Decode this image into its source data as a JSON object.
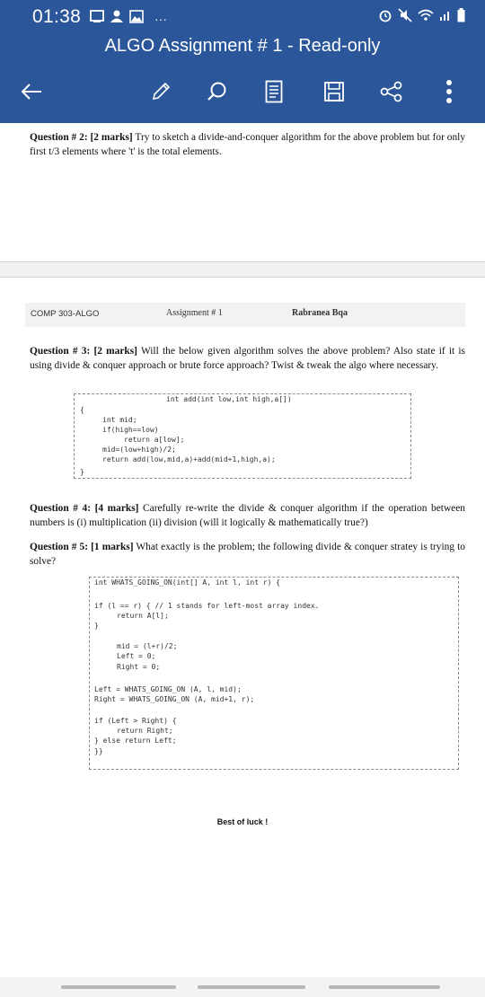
{
  "status_bar": {
    "time": "01:38",
    "more": "···"
  },
  "header": {
    "title": "ALGO Assignment # 1 - Read-only"
  },
  "toolbar": {
    "back_icon": "back-arrow-icon",
    "edit_icon": "pencil-icon",
    "search_icon": "search-icon",
    "reading_mode_icon": "reading-view-icon",
    "save_icon": "save-icon",
    "share_icon": "share-icon",
    "more_icon": "more-vertical-icon"
  },
  "colors": {
    "accent": "#2b579a"
  },
  "document": {
    "q2": {
      "label": "Question # 2: [2 marks]",
      "text": " Try to sketch a divide-and-conquer algorithm for the above problem but for only first t/3 elements where 't' is the total elements."
    },
    "page_header": {
      "course": "COMP 303-ALGO",
      "assignment": "Assignment # 1",
      "author": "Rabranea Bqa"
    },
    "q3": {
      "label": "Question # 3: [2 marks]",
      "text": " Will the below given algorithm solves the above problem? Also state if it is using divide & conquer approach or brute force approach? Twist & tweak the algo where necessary."
    },
    "code1": [
      "int add(int low,int high,a[])",
      "{",
      "int mid;",
      "if(high==low)",
      "return a[low];",
      "mid=(low+high)/2;",
      "return add(low,mid,a)+add(mid+1,high,a);",
      "}"
    ],
    "q4": {
      "label": "Question # 4: [4 marks]",
      "text": " Carefully re-write the divide & conquer algorithm if the operation between numbers is (i) multiplication (ii) division (will it logically & mathematically true?)"
    },
    "q5": {
      "label": "Question # 5: [1 marks]",
      "text": " What exactly is the problem; the following divide & conquer stratey is trying to solve?"
    },
    "code2": [
      "int WHATS_GOING_ON(int[] A, int l, int r) {",
      "if (l == r) { // 1 stands for left-most array index.",
      "return A[l];",
      "}",
      "mid = (l+r)/2;",
      "Left = 0;",
      "Right = 0;",
      "Left = WHATS_GOING_ON (A, l, mid);",
      "Right = WHATS_GOING_ON (A, mid+1, r);",
      "if (Left > Right) {",
      "return Right;",
      "} else return Left;",
      "}}"
    ],
    "closing": "Best of luck !"
  }
}
